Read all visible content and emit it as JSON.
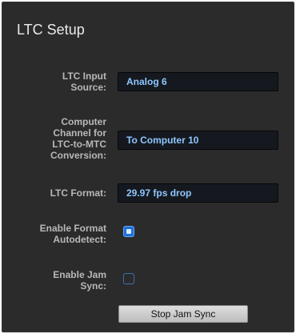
{
  "panel": {
    "title": "LTC Setup"
  },
  "ltc_input_source": {
    "label_line1": "LTC Input",
    "label_line2": "Source:",
    "value": "Analog 6"
  },
  "computer_channel": {
    "label_line1": "Computer",
    "label_line2": "Channel for",
    "label_line3": "LTC-to-MTC",
    "label_line4": "Conversion:",
    "value": "To Computer 10"
  },
  "ltc_format": {
    "label": "LTC Format:",
    "value": "29.97 fps drop"
  },
  "enable_format_autodetect": {
    "label_line1": "Enable Format",
    "label_line2": "Autodetect:",
    "checked": true
  },
  "enable_jam_sync": {
    "label_line1": "Enable Jam",
    "label_line2": "Sync:",
    "checked": false
  },
  "jam_sync_button": {
    "label": "Stop Jam Sync"
  },
  "colors": {
    "panel_bg": "#2b2b2b",
    "label_text": "#b8b8b8",
    "field_bg": "#15191f",
    "field_text": "#8ec6ff",
    "checkbox_on": "#1f6fd6"
  }
}
